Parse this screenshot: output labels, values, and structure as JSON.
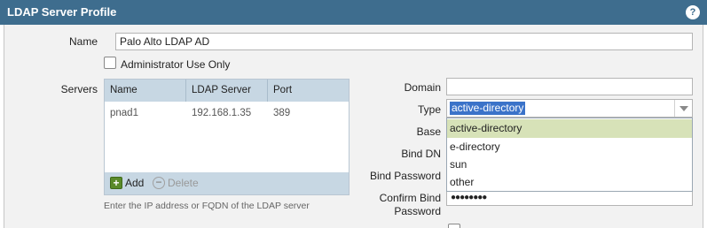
{
  "titlebar": {
    "title": "LDAP Server Profile",
    "help_icon": "?"
  },
  "form": {
    "name_label": "Name",
    "name_value": "Palo Alto LDAP AD",
    "admin_only_label": "Administrator Use Only",
    "servers_label": "Servers",
    "domain_label": "Domain",
    "domain_value": "",
    "type_label": "Type",
    "type_value": "active-directory",
    "base_label": "Base",
    "bind_dn_label": "Bind DN",
    "bind_password_label": "Bind Password",
    "confirm_bind_label": "Confirm Bind",
    "confirm_bind_label2": "Password",
    "confirm_bind_value": "●●●●●●●●"
  },
  "servers_table": {
    "columns": [
      "Name",
      "LDAP Server",
      "Port"
    ],
    "rows": [
      {
        "name": "pnad1",
        "server": "192.168.1.35",
        "port": "389"
      }
    ],
    "add_label": "Add",
    "delete_label": "Delete",
    "hint": "Enter the IP address or FQDN of the LDAP server"
  },
  "type_dropdown": {
    "options": [
      "active-directory",
      "e-directory",
      "sun",
      "other"
    ],
    "selected": "active-directory"
  },
  "colors": {
    "titlebar": "#3e6d8e",
    "selected_option": "#d7e2b8",
    "grid_header": "#c7d7e3"
  }
}
